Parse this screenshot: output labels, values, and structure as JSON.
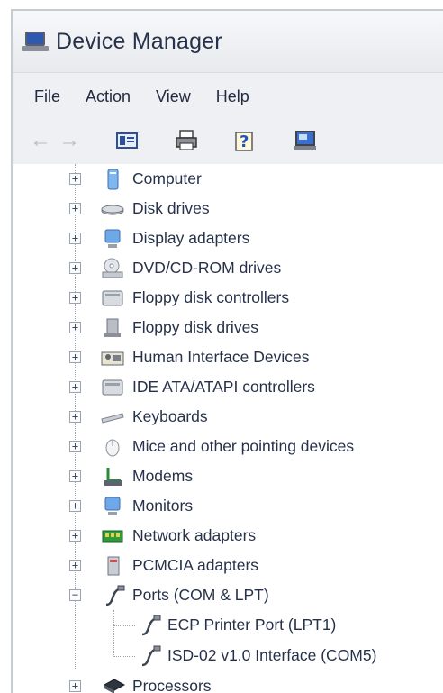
{
  "window": {
    "title": "Device Manager"
  },
  "menu": [
    "File",
    "Action",
    "View",
    "Help"
  ],
  "toolbar": [
    "back-icon",
    "forward-icon",
    "properties-icon",
    "print-icon",
    "help-icon",
    "scan-hardware-icon"
  ],
  "tree": {
    "categories": [
      {
        "label": "Computer",
        "icon": "computer-icon",
        "expander": "+"
      },
      {
        "label": "Disk drives",
        "icon": "disk-drive-icon",
        "expander": "+"
      },
      {
        "label": "Display adapters",
        "icon": "display-adapter-icon",
        "expander": "+"
      },
      {
        "label": "DVD/CD-ROM drives",
        "icon": "dvd-drive-icon",
        "expander": "+"
      },
      {
        "label": "Floppy disk controllers",
        "icon": "floppy-controller-icon",
        "expander": "+"
      },
      {
        "label": "Floppy disk drives",
        "icon": "floppy-drive-icon",
        "expander": "+"
      },
      {
        "label": "Human Interface Devices",
        "icon": "hid-icon",
        "expander": "+"
      },
      {
        "label": "IDE ATA/ATAPI controllers",
        "icon": "ide-controller-icon",
        "expander": "+"
      },
      {
        "label": "Keyboards",
        "icon": "keyboard-icon",
        "expander": "+"
      },
      {
        "label": "Mice and other pointing devices",
        "icon": "mouse-icon",
        "expander": "+"
      },
      {
        "label": "Modems",
        "icon": "modem-icon",
        "expander": "+"
      },
      {
        "label": "Monitors",
        "icon": "monitor-icon",
        "expander": "+"
      },
      {
        "label": "Network adapters",
        "icon": "network-adapter-icon",
        "expander": "+"
      },
      {
        "label": "PCMCIA adapters",
        "icon": "pcmcia-icon",
        "expander": "+"
      },
      {
        "label": "Ports (COM & LPT)",
        "icon": "port-icon",
        "expander": "−"
      },
      {
        "label": "Processors",
        "icon": "processor-icon",
        "expander": "+"
      }
    ],
    "ports_children": [
      {
        "label": "ECP Printer Port (LPT1)",
        "icon": "port-icon"
      },
      {
        "label": "ISD-02 v1.0 Interface (COM5)",
        "icon": "port-icon"
      }
    ]
  }
}
